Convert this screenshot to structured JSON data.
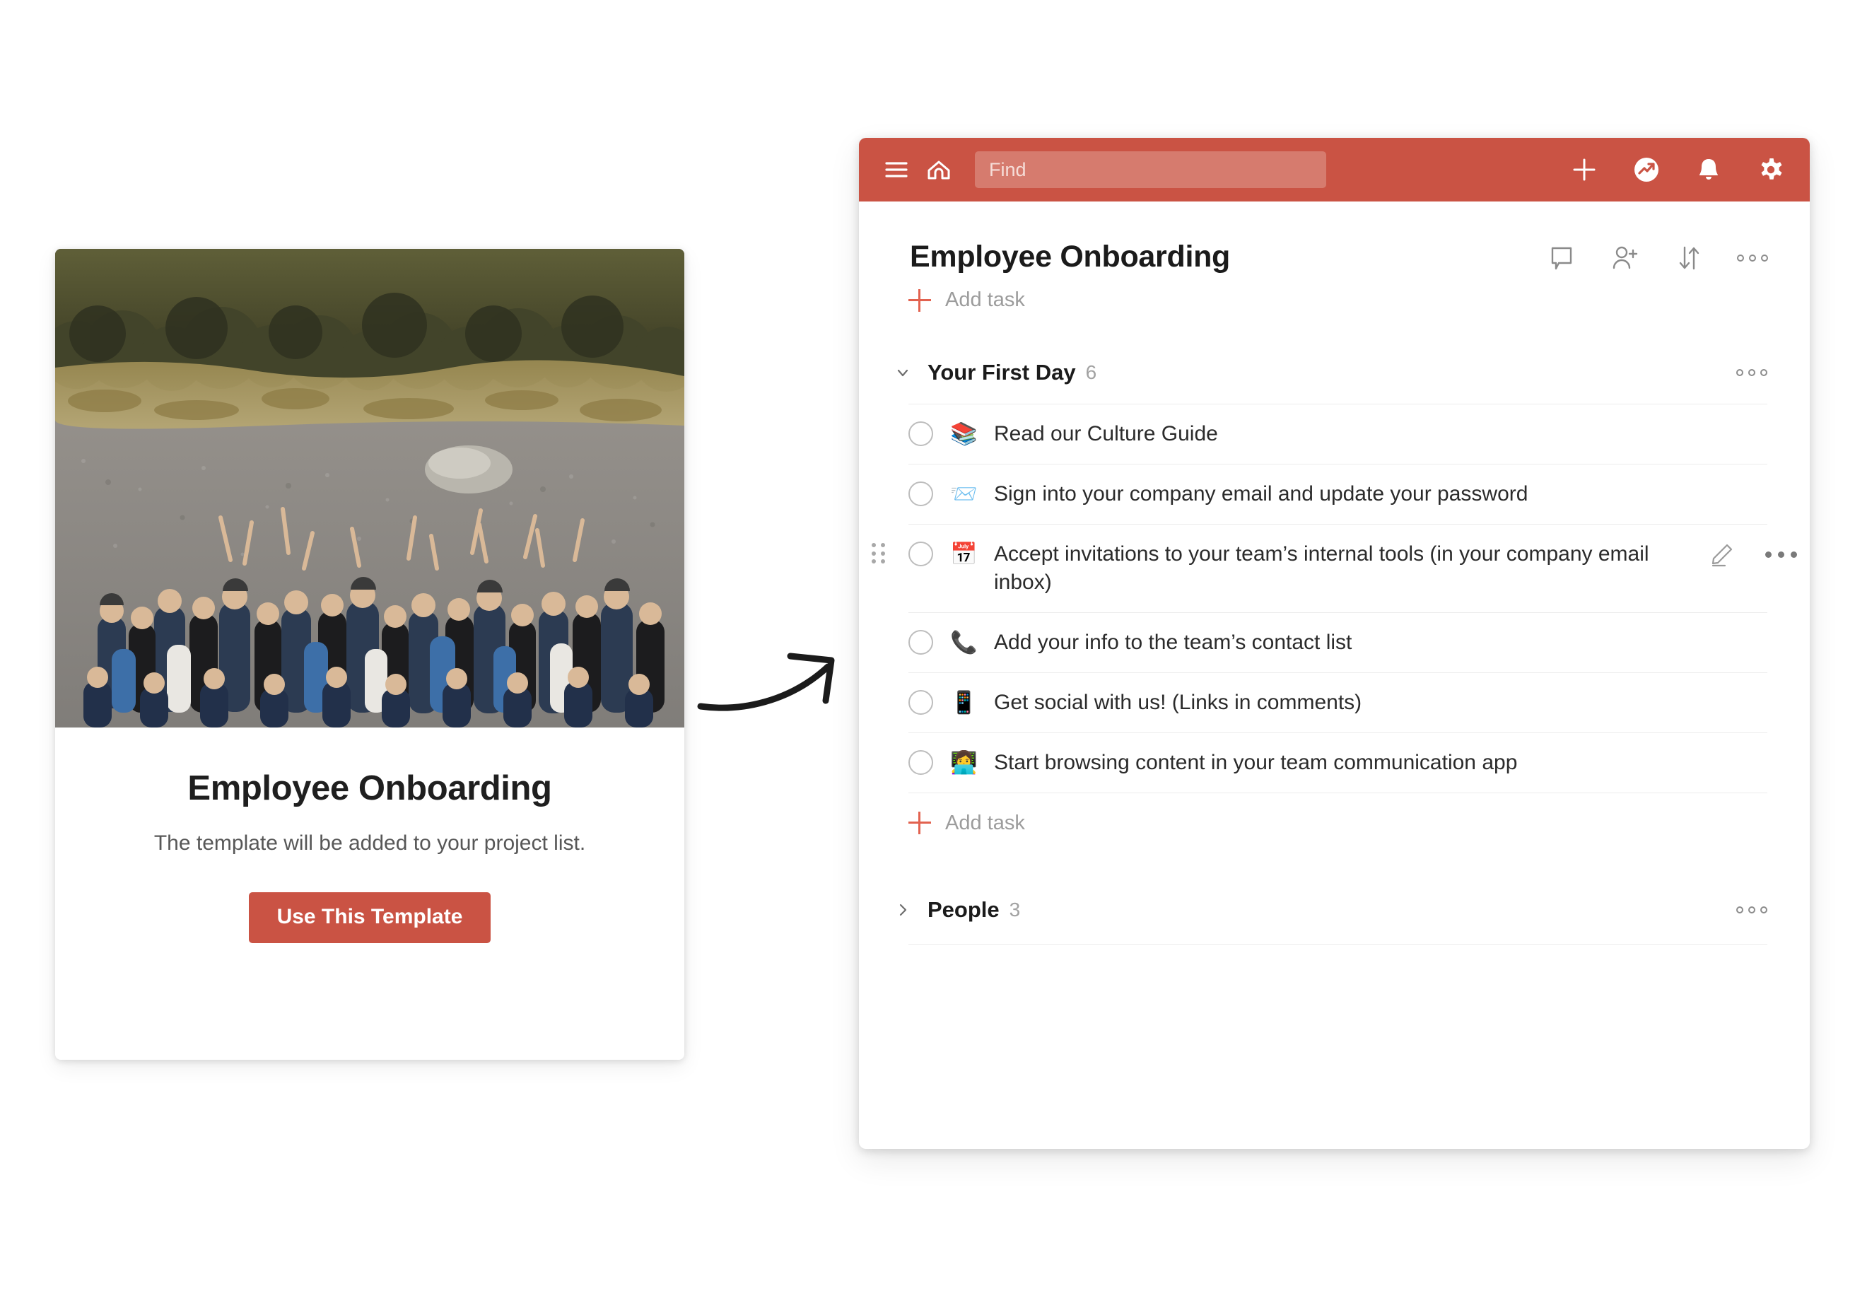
{
  "template_card": {
    "photo_alt": "aerial group photo of a large team cheering on gravel in front of trees",
    "title": "Employee Onboarding",
    "subtitle": "The template will be added to your project list.",
    "button_label": "Use This Template"
  },
  "arrow": {
    "name": "curved-arrow",
    "direction": "up-right"
  },
  "app": {
    "brand_color": "#ca5344",
    "topbar": {
      "menu_icon": "hamburger-menu-icon",
      "home_icon": "home-icon",
      "search": {
        "placeholder": "Find",
        "value": ""
      },
      "actions": [
        {
          "icon": "plus-icon",
          "name": "add-button"
        },
        {
          "icon": "trending-up-circle-icon",
          "name": "insights-button"
        },
        {
          "icon": "bell-icon",
          "name": "notifications-button"
        },
        {
          "icon": "gear-icon",
          "name": "settings-button"
        }
      ]
    },
    "project": {
      "title": "Employee Onboarding",
      "actions": [
        {
          "icon": "comment-icon",
          "name": "comments-button"
        },
        {
          "icon": "add-person-icon",
          "name": "share-button"
        },
        {
          "icon": "sort-arrows-icon",
          "name": "sort-button"
        },
        {
          "icon": "ellipsis-icon",
          "name": "project-more-button"
        }
      ],
      "add_task_label": "Add task"
    },
    "sections": [
      {
        "name": "Your First Day",
        "count": "6",
        "expanded": true,
        "chevron": "chevron-down-icon",
        "more_icon": "ellipsis-icon",
        "add_task_label": "Add task",
        "tasks": [
          {
            "emoji": "📚",
            "emoji_name": "books-emoji",
            "text": "Read our Culture Guide",
            "checked": false
          },
          {
            "emoji": "📨",
            "emoji_name": "incoming-envelope-emoji",
            "text": "Sign into your company email and update your password",
            "checked": false
          },
          {
            "emoji": "📅",
            "emoji_name": "calendar-emoji",
            "text": "Accept invitations to your team’s internal tools (in your company email inbox)",
            "checked": false,
            "hovered": true
          },
          {
            "emoji": "📞",
            "emoji_name": "telephone-receiver-emoji",
            "text": "Add your info to the team’s contact list",
            "checked": false
          },
          {
            "emoji": "📱",
            "emoji_name": "mobile-phone-emoji",
            "text": "Get social with us! (Links in comments)",
            "checked": false
          },
          {
            "emoji": "👩‍💻",
            "emoji_name": "woman-technologist-emoji",
            "text": "Start browsing content in your team communication app",
            "checked": false
          }
        ]
      },
      {
        "name": "People",
        "count": "3",
        "expanded": false,
        "chevron": "chevron-right-icon",
        "more_icon": "ellipsis-icon",
        "tasks": []
      }
    ]
  }
}
